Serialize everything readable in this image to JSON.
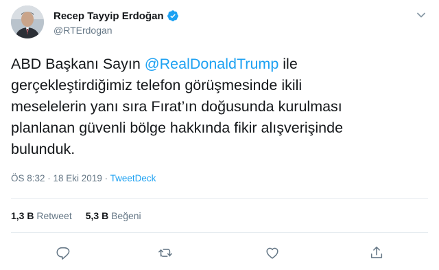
{
  "user": {
    "display_name": "Recep Tayyip Erdoğan",
    "handle": "@RTErdogan",
    "verified_icon": "verified-badge-icon"
  },
  "tweet": {
    "text_before_mention": "ABD Başkanı Sayın ",
    "mention": "@RealDonaldTrump",
    "text_after_mention": " ile\ngerçekleştirdiğimiz telefon görüşmesinde ikili\nmeselelerin yanı sıra Fırat’ın doğusunda kurulması\nplanlanan güvenli bölge hakkında fikir alışverişinde\nbulunduk."
  },
  "meta": {
    "time": "ÖS 8:32",
    "separator": " · ",
    "date": "18 Eki 2019",
    "source": "TweetDeck"
  },
  "stats": {
    "retweets_count": "1,3 B",
    "retweets_label": "Retweet",
    "likes_count": "5,3 B",
    "likes_label": "Beğeni"
  },
  "actions": [
    "reply-icon",
    "retweet-icon",
    "like-icon",
    "share-icon"
  ],
  "colors": {
    "accent": "#1da1f2",
    "text": "#14171a",
    "secondary": "#657786",
    "divider": "#e6ecf0"
  }
}
